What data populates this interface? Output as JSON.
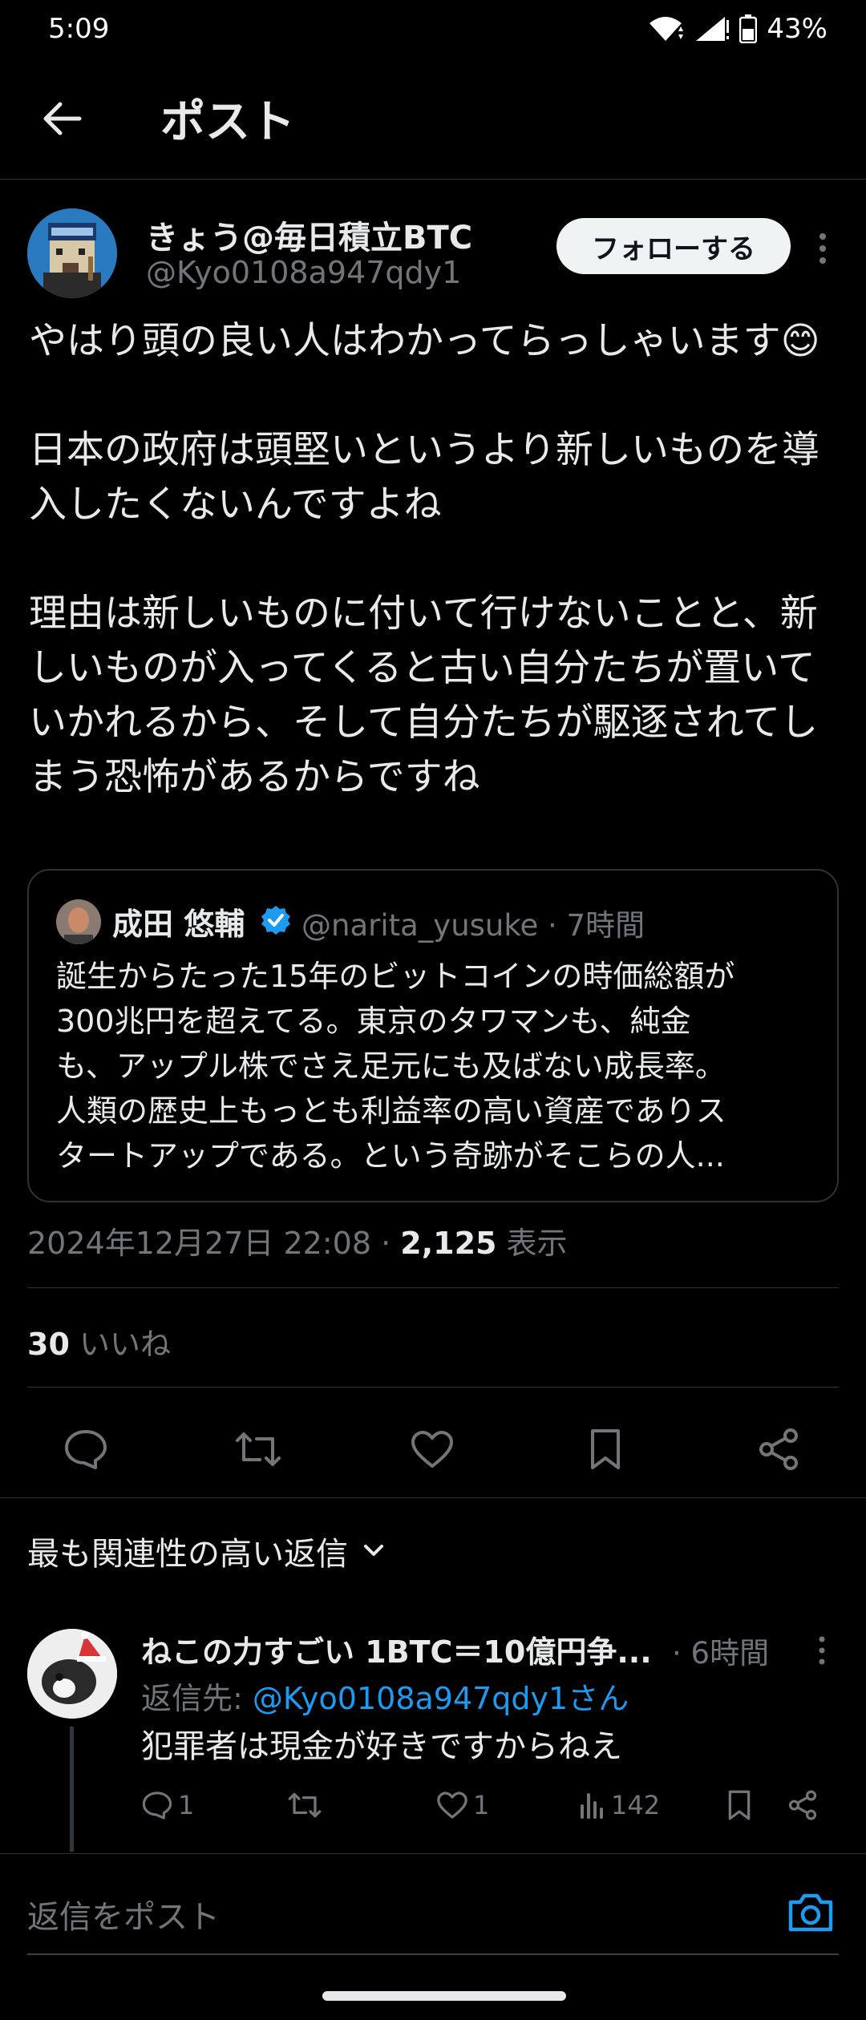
{
  "status_bar": {
    "time": "5:09",
    "battery": "43%"
  },
  "header": {
    "title": "ポスト"
  },
  "author": {
    "name": "きょう@毎日積立BTC",
    "handle": "@Kyo0108a947qdy1",
    "follow_label": "フォローする"
  },
  "tweet": {
    "text": "やはり頭の良い人はわかってらっしゃいます😊\n\n日本の政府は頭堅いというより新しいものを導入したくないんですよね\n\n理由は新しいものに付いて行けないことと、新しいものが入ってくると古い自分たちが置いていかれるから、そして自分たちが駆逐されてしまう恐怖があるからですね",
    "timestamp": "2024年12月27日 22:08 · ",
    "views": "2,125",
    "views_label": " 表示",
    "likes_count": "30",
    "likes_label": " いいね"
  },
  "quote": {
    "name": "成田 悠輔",
    "handle_time": "@narita_yusuke · 7時間",
    "lines": [
      "誕生からたった15年のビットコインの時価総額が",
      "300兆円を超えてる。東京のタワマンも、純金",
      "も、アップル株でさえ足元にも及ばない成長率。",
      "人類の歴史上もっとも利益率の高い資産でありス",
      "タートアップである。という奇跡がそこらの人..."
    ]
  },
  "replies": {
    "sort_label": "最も関連性の高い返信",
    "items": [
      {
        "name": "ねこの力すごい 1BTC＝10億円争...",
        "time": "· 6時間",
        "reply_to_prefix": "返信先: ",
        "reply_to_user": "@Kyo0108a947qdy1さん",
        "text": "犯罪者は現金が好きですからねえ",
        "reply_count": "1",
        "like_count": "1",
        "view_count": "142"
      }
    ]
  },
  "compose": {
    "placeholder": "返信をポスト"
  },
  "icons": {
    "back": "arrow-left-icon",
    "reply": "speech-bubble-icon",
    "repost": "repost-arrows-icon",
    "like": "heart-icon",
    "bookmark": "bookmark-icon",
    "share": "share-icon",
    "camera": "camera-icon",
    "verified": "verified-badge-icon"
  },
  "colors": {
    "background": "#000000",
    "text": "#e7e9ea",
    "muted": "#71767b",
    "link": "#1d9bf0",
    "verified": "#1d9bf0"
  }
}
